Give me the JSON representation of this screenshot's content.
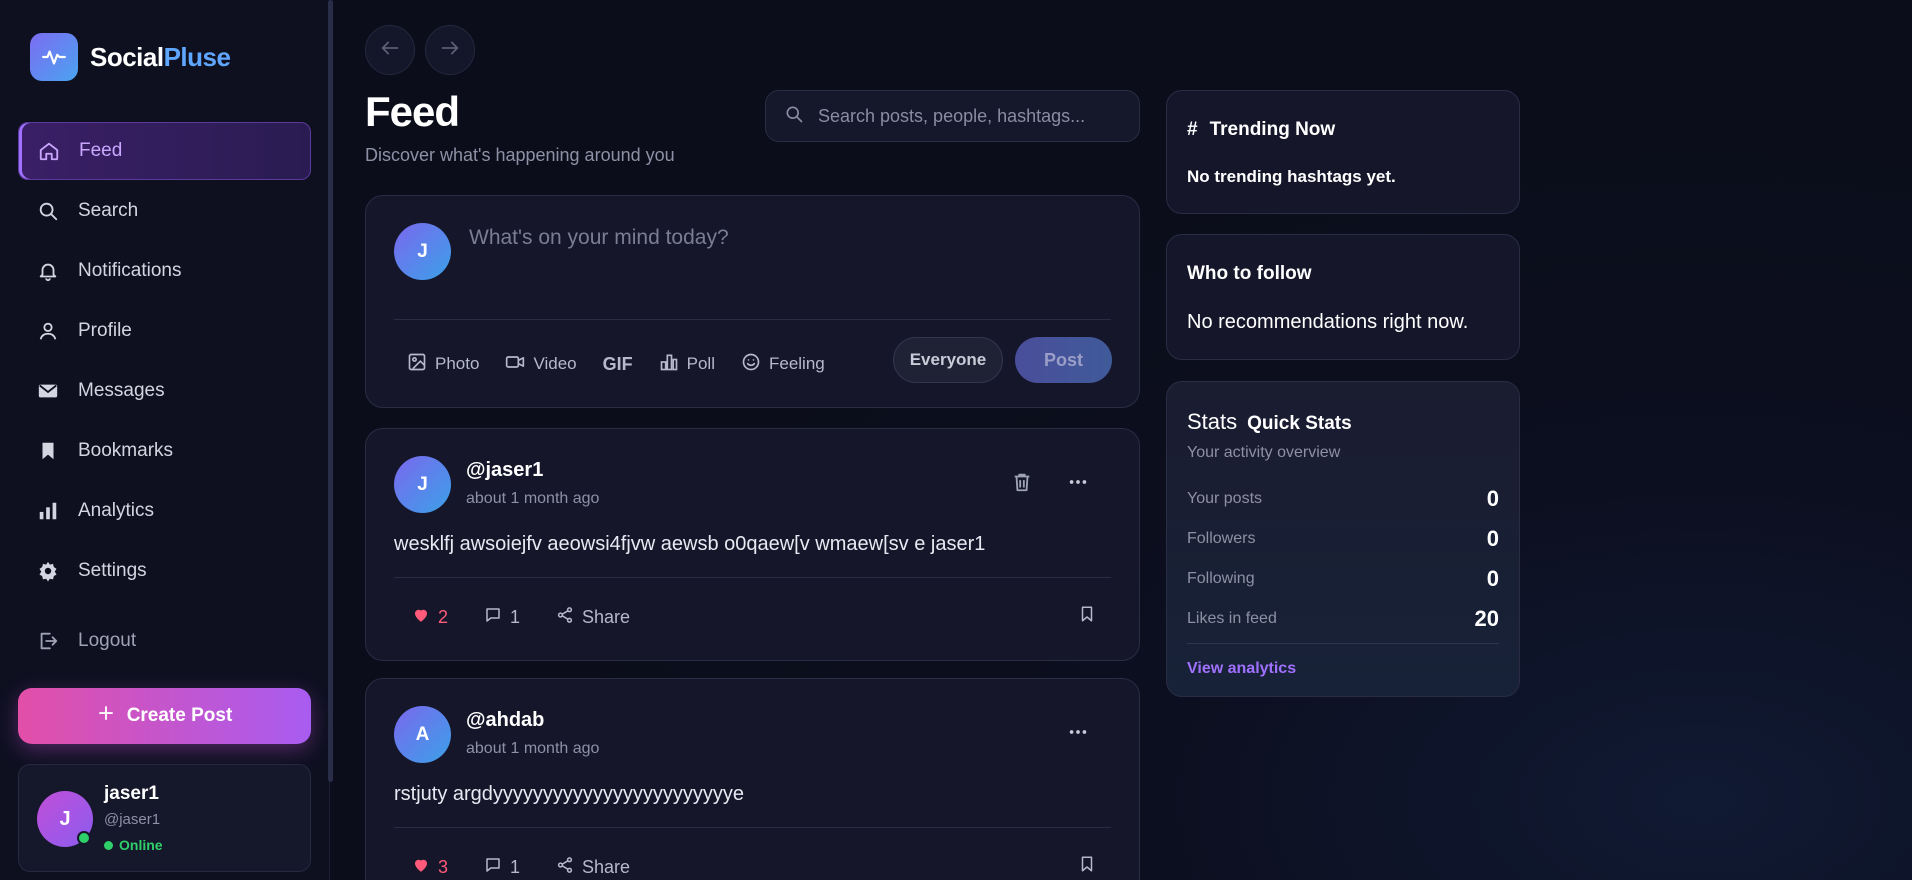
{
  "brand": {
    "name_part1": "Social",
    "name_part2": "Pluse"
  },
  "nav": {
    "feed": "Feed",
    "search": "Search",
    "notifications": "Notifications",
    "profile": "Profile",
    "messages": "Messages",
    "bookmarks": "Bookmarks",
    "analytics": "Analytics",
    "settings": "Settings",
    "logout": "Logout"
  },
  "create_post": "Create Post",
  "current_user": {
    "initial": "J",
    "name": "jaser1",
    "handle": "@jaser1",
    "status": "Online"
  },
  "page": {
    "title": "Feed",
    "subtitle": "Discover what's happening around you"
  },
  "search": {
    "placeholder": "Search posts, people, hashtags..."
  },
  "composer": {
    "initial": "J",
    "placeholder": "What's on your mind today?",
    "tools": {
      "photo": "Photo",
      "video": "Video",
      "gif": "GIF",
      "poll": "Poll",
      "feeling": "Feeling"
    },
    "audience": "Everyone",
    "post": "Post"
  },
  "posts": [
    {
      "initial": "J",
      "user": "@jaser1",
      "time": "about 1 month ago",
      "text": "wesklfj awsoiejfv aeowsi4fjvw aewsb o0qaew[v wmaew[sv e jaser1",
      "likes": "2",
      "comments": "1",
      "share": "Share"
    },
    {
      "initial": "A",
      "user": "@ahdab",
      "time": "about 1 month ago",
      "text": "rstjuty argdyyyyyyyyyyyyyyyyyyyyyyyye",
      "likes": "3",
      "comments": "1",
      "share": "Share"
    }
  ],
  "trending": {
    "hash": "#",
    "title": "Trending Now",
    "empty": "No trending hashtags yet."
  },
  "who_to_follow": {
    "title": "Who to follow",
    "empty": "No recommendations right now."
  },
  "stats": {
    "icon_label": "Stats",
    "title": "Quick Stats",
    "subtitle": "Your activity overview",
    "rows": [
      {
        "label": "Your posts",
        "value": "0"
      },
      {
        "label": "Followers",
        "value": "0"
      },
      {
        "label": "Following",
        "value": "0"
      },
      {
        "label": "Likes in feed",
        "value": "20"
      }
    ],
    "link": "View analytics"
  },
  "colors": {
    "accent": "#a070ff",
    "brand_blue": "#5fa6ff",
    "like": "#ff5a7a",
    "online": "#2fcf6a"
  }
}
